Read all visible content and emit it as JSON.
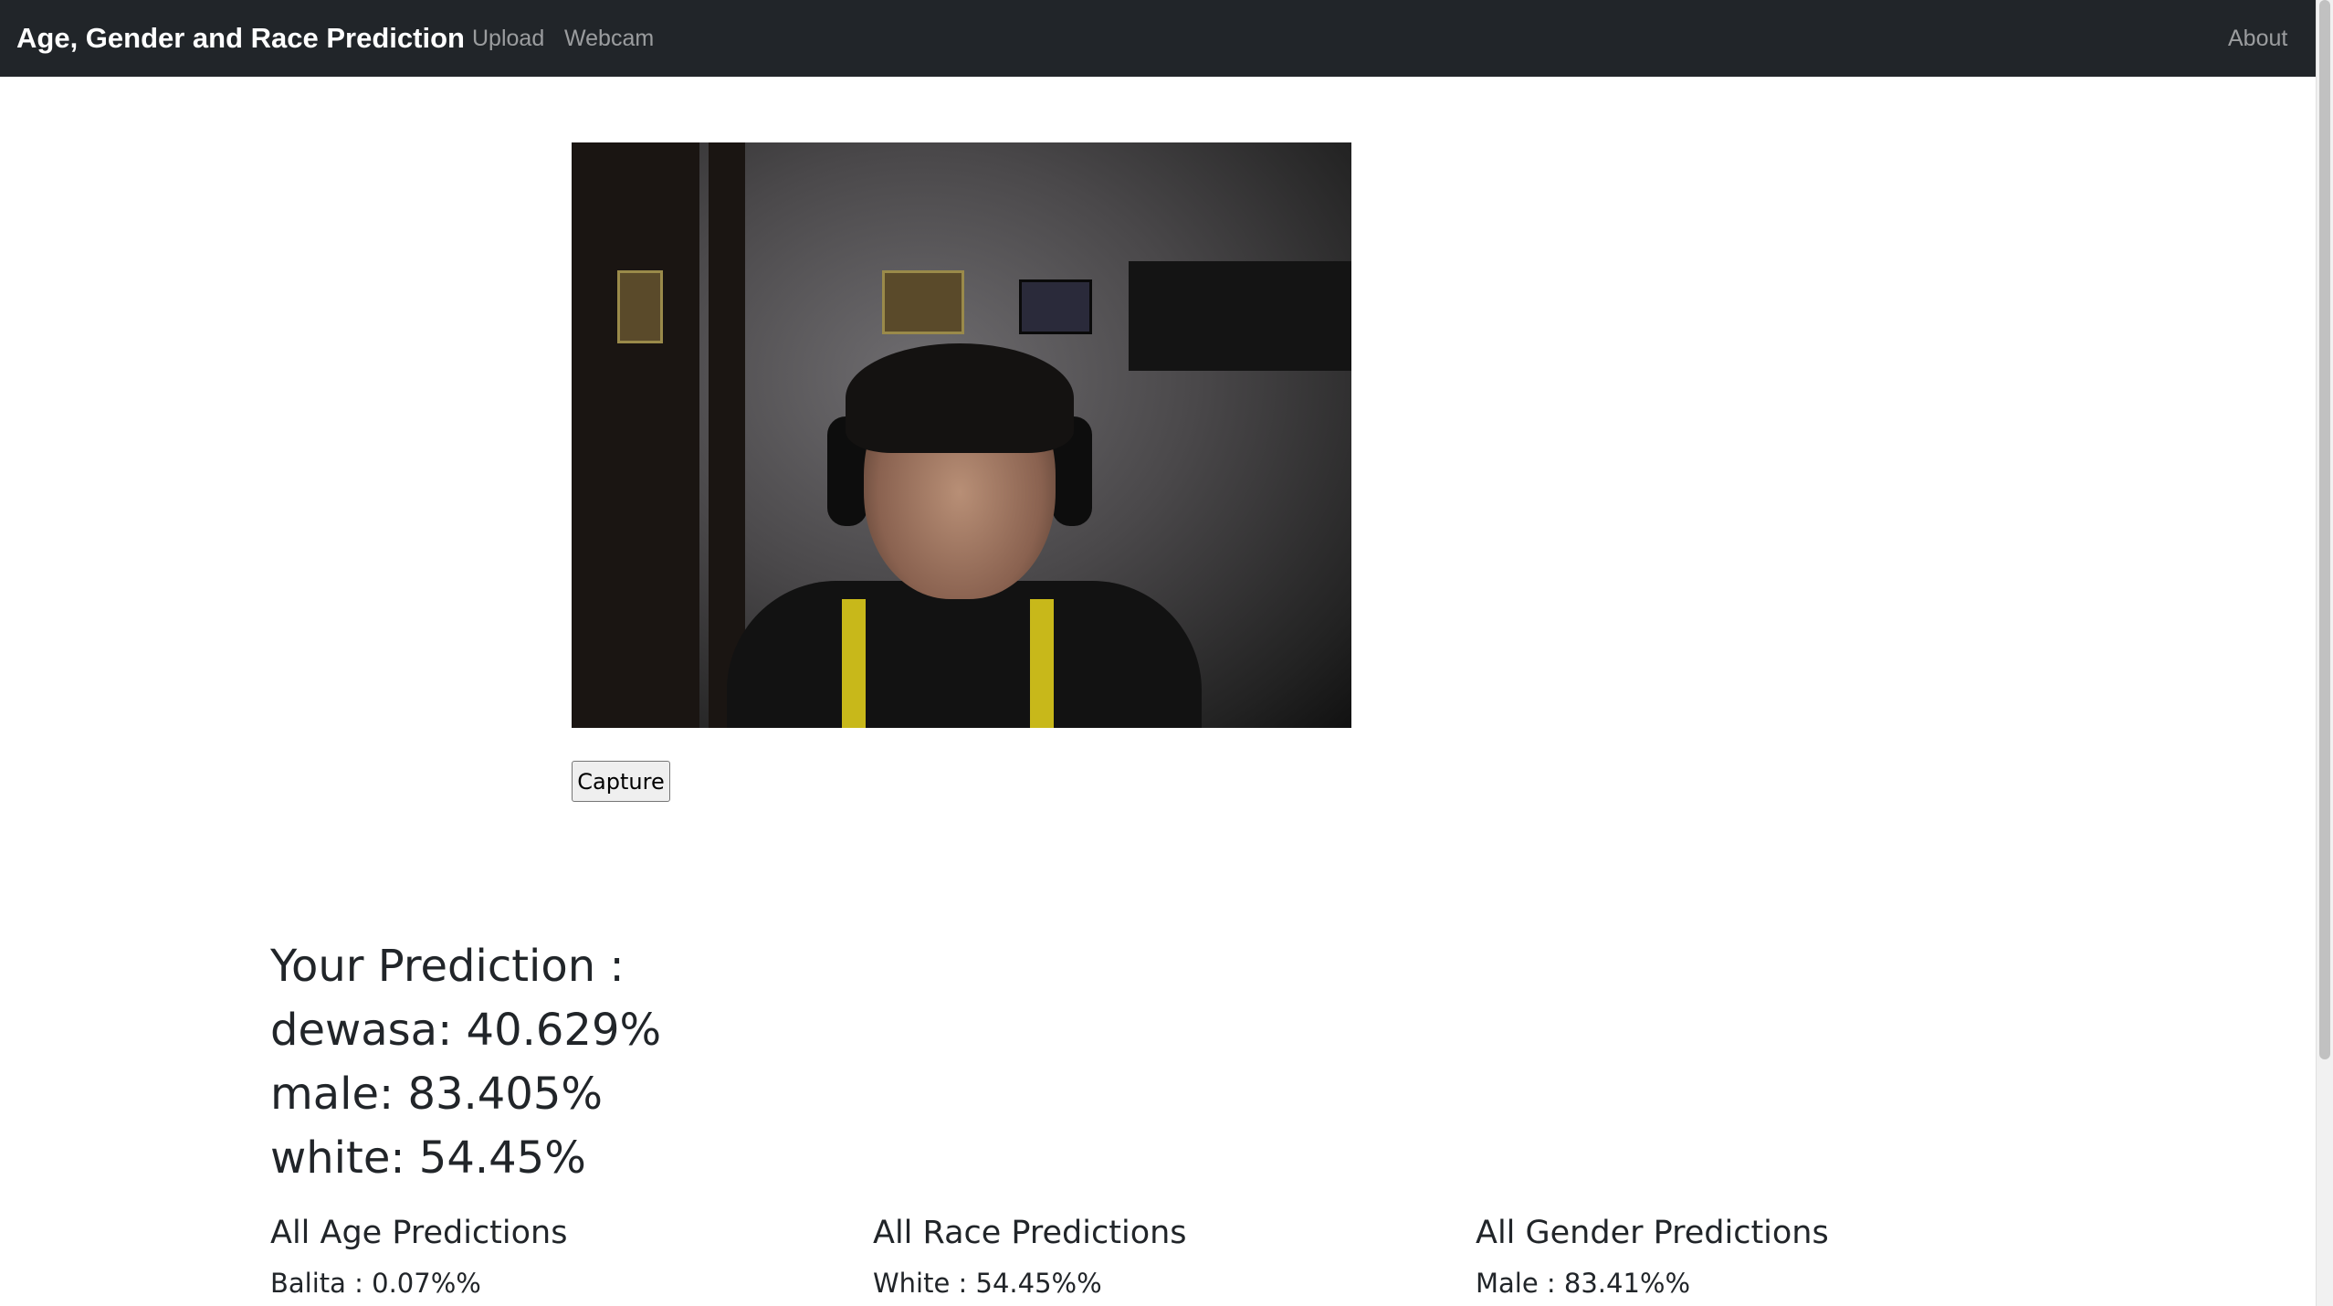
{
  "navbar": {
    "brand": "Age, Gender and Race Prediction",
    "links": [
      "Upload",
      "Webcam"
    ],
    "about": "About"
  },
  "webcam": {
    "capture_label": "Capture"
  },
  "prediction": {
    "heading": "Your Prediction :",
    "age": "dewasa: 40.629%",
    "gender": "male: 83.405%",
    "race": "white: 54.45%"
  },
  "columns": [
    {
      "title": "All Age Predictions",
      "first_item": "Balita : 0.07%%"
    },
    {
      "title": "All Race Predictions",
      "first_item": "White : 54.45%%"
    },
    {
      "title": "All Gender Predictions",
      "first_item": "Male : 83.41%%"
    }
  ],
  "colors": {
    "navbar_bg": "#212529",
    "brand": "#ffffff",
    "nav_link": "rgba(255,255,255,0.55)"
  }
}
